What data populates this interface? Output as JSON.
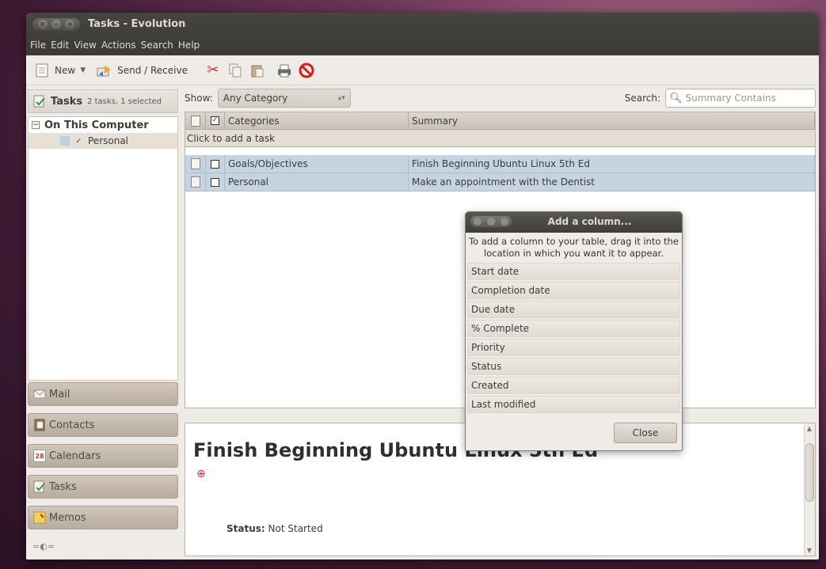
{
  "window": {
    "title": "Tasks - Evolution"
  },
  "menu": [
    "File",
    "Edit",
    "View",
    "Actions",
    "Search",
    "Help"
  ],
  "toolbar": {
    "new_label": "New",
    "send_receive_label": "Send / Receive"
  },
  "sidebar": {
    "header_title": "Tasks",
    "header_sub": "2 tasks, 1 selected",
    "group": "On This Computer",
    "list": "Personal"
  },
  "switcher": {
    "mail": "Mail",
    "contacts": "Contacts",
    "calendars": "Calendars",
    "calendar_day": "28",
    "tasks": "Tasks",
    "memos": "Memos"
  },
  "filter": {
    "show_label": "Show:",
    "category_value": "Any Category",
    "search_label": "Search:",
    "search_placeholder": "Summary Contains"
  },
  "table": {
    "col_categories": "Categories",
    "col_summary": "Summary",
    "add_task": "Click to add a task",
    "rows": [
      {
        "category": "Goals/Objectives",
        "summary": "Finish Beginning Ubuntu Linux 5th Ed"
      },
      {
        "category": "Personal",
        "summary": "Make an appointment with the Dentist"
      }
    ]
  },
  "preview": {
    "title": "Finish Beginning Ubuntu Linux 5th Ed",
    "status_label": "Status:",
    "status_value": "Not Started"
  },
  "dialog": {
    "title": "Add a column...",
    "instruction": "To add a column to your table, drag it into the location in which you want it to appear.",
    "items": [
      "Start date",
      "Completion date",
      "Due date",
      "% Complete",
      "Priority",
      "Status",
      "Created",
      "Last modified"
    ],
    "close_label": "Close"
  }
}
